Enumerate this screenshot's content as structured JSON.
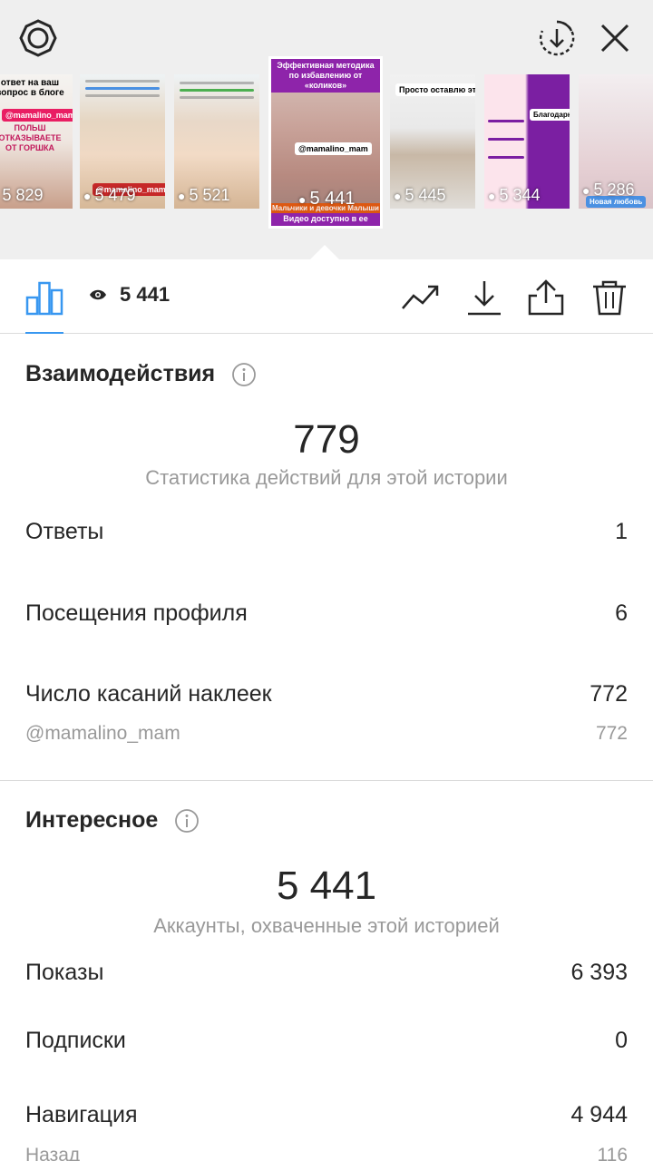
{
  "stories": [
    {
      "views": "5 829",
      "headline": "ответ на ваш вопрос в блоге",
      "tag": "@mamalino_mam",
      "footer": "ПОЛЬШ ОТКАЗЫВАЕТЕ ОТ ГОРШКА"
    },
    {
      "views": "5 479",
      "tag": "@mamalino_mam"
    },
    {
      "views": "5 521"
    },
    {
      "views": "5 441",
      "headline": "Эффективная методика по избавлению от «коликов»",
      "tag": "@mamalino_mam",
      "footer": "Видео доступно в ее аккаунте",
      "footer2": "Мальчики и девочки Малыши"
    },
    {
      "views": "5 445",
      "headline": "Просто оставлю это здесь"
    },
    {
      "views": "5 344",
      "headline": "Благодарю"
    },
    {
      "views": "5 286",
      "footer": "Новая любовь"
    }
  ],
  "toolbar": {
    "views": "5 441"
  },
  "interactions": {
    "title": "Взаимодействия",
    "total": "779",
    "subtitle": "Статистика действий для этой истории",
    "rows": [
      {
        "label": "Ответы",
        "value": "1"
      },
      {
        "label": "Посещения профиля",
        "value": "6"
      },
      {
        "label": "Число касаний наклеек",
        "value": "772"
      }
    ],
    "sticker_sub": {
      "label": "@mamalino_mam",
      "value": "772"
    }
  },
  "discovery": {
    "title": "Интересное",
    "total": "5 441",
    "subtitle": "Аккаунты, охваченные этой историей",
    "rows": [
      {
        "label": "Показы",
        "value": "6 393"
      },
      {
        "label": "Подписки",
        "value": "0"
      },
      {
        "label": "Навигация",
        "value": "4 944"
      }
    ],
    "nav_sub": {
      "label": "Назад",
      "value": "116"
    }
  },
  "colors": {
    "accent": "#3897f0",
    "text": "#262626",
    "muted": "#999999",
    "divider": "#dbdbdb",
    "strip_bg": "#efefef"
  }
}
